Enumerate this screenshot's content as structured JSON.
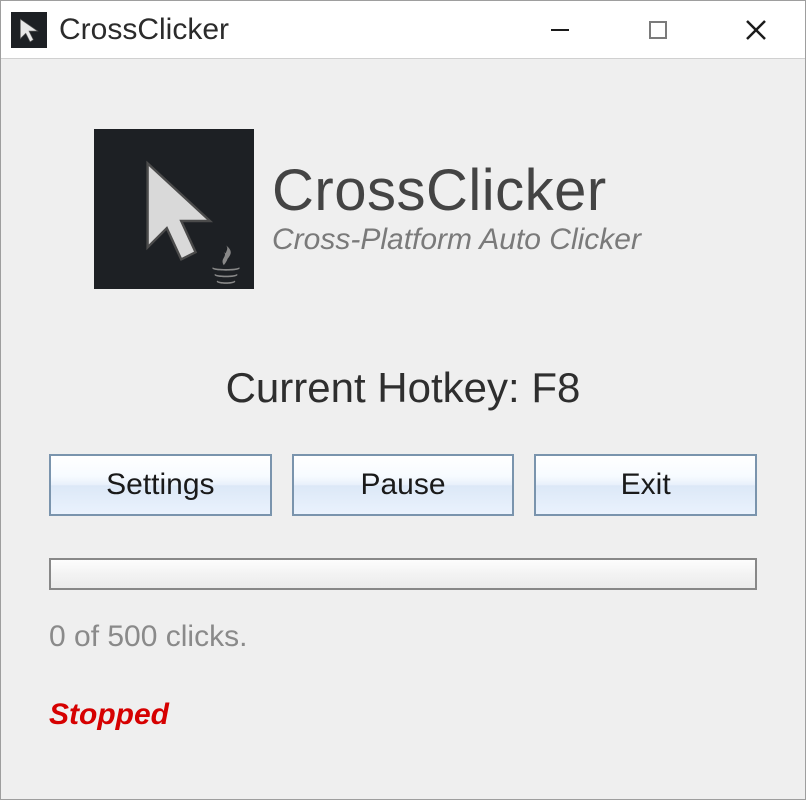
{
  "window": {
    "title": "CrossClicker"
  },
  "branding": {
    "app_name": "CrossClicker",
    "tagline": "Cross-Platform Auto Clicker"
  },
  "hotkey": {
    "label": "Current Hotkey: F8"
  },
  "buttons": {
    "settings": "Settings",
    "pause": "Pause",
    "exit": "Exit"
  },
  "progress": {
    "percent": 0
  },
  "counter": {
    "text": "0 of 500 clicks."
  },
  "status": {
    "text": "Stopped",
    "color": "#d60000"
  }
}
